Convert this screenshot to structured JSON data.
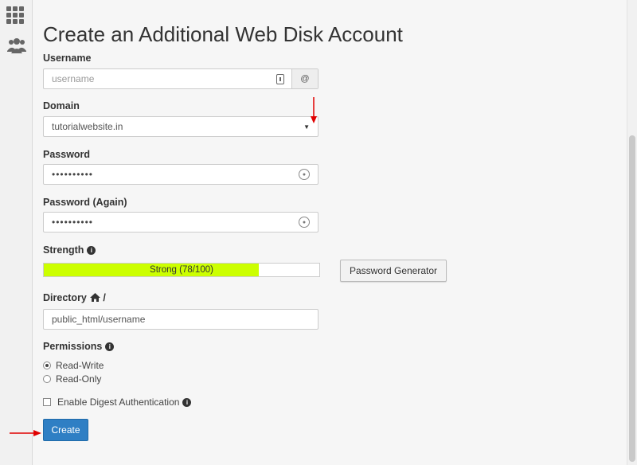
{
  "page": {
    "title": "Create an Additional Web Disk Account"
  },
  "form": {
    "username": {
      "label": "Username",
      "placeholder": "username",
      "suffix": "@"
    },
    "domain": {
      "label": "Domain",
      "value": "tutorialwebsite.in"
    },
    "password": {
      "label": "Password",
      "value": "••••••••••"
    },
    "password_again": {
      "label": "Password (Again)",
      "value": "••••••••••"
    },
    "strength": {
      "label": "Strength",
      "text": "Strong (78/100)",
      "score": 78,
      "fill_color": "#ccff00"
    },
    "generator_button": "Password Generator",
    "directory": {
      "label": "Directory",
      "suffix": "/",
      "value": "public_html/username"
    },
    "permissions": {
      "label": "Permissions",
      "options": [
        "Read-Write",
        "Read-Only"
      ],
      "selected": "Read-Write"
    },
    "digest": {
      "label": "Enable Digest Authentication",
      "checked": false
    },
    "create_button": "Create"
  },
  "colors": {
    "accent": "#2f7fc4",
    "annotation_arrow": "#e00000"
  }
}
